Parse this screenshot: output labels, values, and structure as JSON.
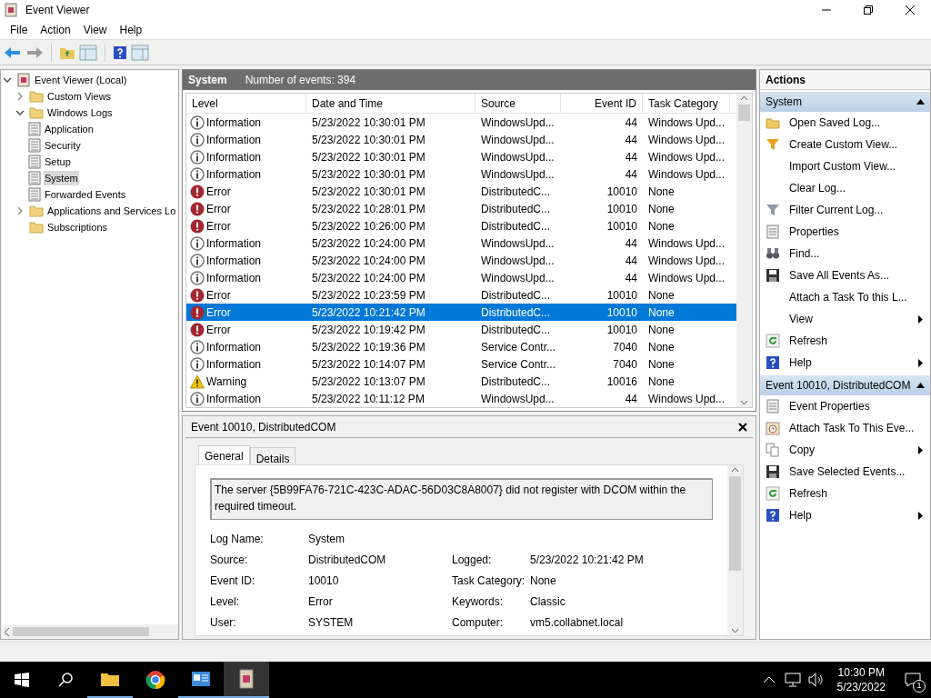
{
  "window": {
    "title": "Event Viewer"
  },
  "menu": [
    "File",
    "Action",
    "View",
    "Help"
  ],
  "tree": [
    {
      "label": "Event Viewer (Local)",
      "kind": "viewer",
      "expanded": true,
      "selected": false,
      "children": [
        {
          "label": "Custom Views",
          "kind": "folder",
          "expanded": false,
          "selected": false
        },
        {
          "label": "Windows Logs",
          "kind": "folder",
          "expanded": true,
          "selected": false,
          "children": [
            {
              "label": "Application",
              "kind": "log",
              "selected": false
            },
            {
              "label": "Security",
              "kind": "log",
              "selected": false
            },
            {
              "label": "Setup",
              "kind": "log",
              "selected": false
            },
            {
              "label": "System",
              "kind": "log",
              "selected": true
            },
            {
              "label": "Forwarded Events",
              "kind": "log",
              "selected": false
            }
          ]
        },
        {
          "label": "Applications and Services Lo",
          "kind": "folder",
          "expanded": false,
          "selected": false
        },
        {
          "label": "Subscriptions",
          "kind": "folder",
          "selected": false
        }
      ]
    }
  ],
  "events": {
    "title": "System",
    "count": "Number of events: 394",
    "columns": [
      "Level",
      "Date and Time",
      "Source",
      "Event ID",
      "Task Category"
    ],
    "rows": [
      {
        "kind": "info",
        "level": "Information",
        "date": "5/23/2022 10:30:01 PM",
        "source": "WindowsUpd...",
        "id": "44",
        "category": "Windows Upd...",
        "selected": false
      },
      {
        "kind": "info",
        "level": "Information",
        "date": "5/23/2022 10:30:01 PM",
        "source": "WindowsUpd...",
        "id": "44",
        "category": "Windows Upd...",
        "selected": false
      },
      {
        "kind": "info",
        "level": "Information",
        "date": "5/23/2022 10:30:01 PM",
        "source": "WindowsUpd...",
        "id": "44",
        "category": "Windows Upd...",
        "selected": false
      },
      {
        "kind": "info",
        "level": "Information",
        "date": "5/23/2022 10:30:01 PM",
        "source": "WindowsUpd...",
        "id": "44",
        "category": "Windows Upd...",
        "selected": false
      },
      {
        "kind": "error",
        "level": "Error",
        "date": "5/23/2022 10:30:01 PM",
        "source": "DistributedC...",
        "id": "10010",
        "category": "None",
        "selected": false
      },
      {
        "kind": "error",
        "level": "Error",
        "date": "5/23/2022 10:28:01 PM",
        "source": "DistributedC...",
        "id": "10010",
        "category": "None",
        "selected": false
      },
      {
        "kind": "error",
        "level": "Error",
        "date": "5/23/2022 10:26:00 PM",
        "source": "DistributedC...",
        "id": "10010",
        "category": "None",
        "selected": false
      },
      {
        "kind": "info",
        "level": "Information",
        "date": "5/23/2022 10:24:00 PM",
        "source": "WindowsUpd...",
        "id": "44",
        "category": "Windows Upd...",
        "selected": false
      },
      {
        "kind": "info",
        "level": "Information",
        "date": "5/23/2022 10:24:00 PM",
        "source": "WindowsUpd...",
        "id": "44",
        "category": "Windows Upd...",
        "selected": false
      },
      {
        "kind": "info",
        "level": "Information",
        "date": "5/23/2022 10:24:00 PM",
        "source": "WindowsUpd...",
        "id": "44",
        "category": "Windows Upd...",
        "selected": false
      },
      {
        "kind": "error",
        "level": "Error",
        "date": "5/23/2022 10:23:59 PM",
        "source": "DistributedC...",
        "id": "10010",
        "category": "None",
        "selected": false
      },
      {
        "kind": "error",
        "level": "Error",
        "date": "5/23/2022 10:21:42 PM",
        "source": "DistributedC...",
        "id": "10010",
        "category": "None",
        "selected": true
      },
      {
        "kind": "error",
        "level": "Error",
        "date": "5/23/2022 10:19:42 PM",
        "source": "DistributedC...",
        "id": "10010",
        "category": "None",
        "selected": false
      },
      {
        "kind": "info",
        "level": "Information",
        "date": "5/23/2022 10:19:36 PM",
        "source": "Service Contr...",
        "id": "7040",
        "category": "None",
        "selected": false
      },
      {
        "kind": "info",
        "level": "Information",
        "date": "5/23/2022 10:14:07 PM",
        "source": "Service Contr...",
        "id": "7040",
        "category": "None",
        "selected": false
      },
      {
        "kind": "warning",
        "level": "Warning",
        "date": "5/23/2022 10:13:07 PM",
        "source": "DistributedC...",
        "id": "10016",
        "category": "None",
        "selected": false
      },
      {
        "kind": "info",
        "level": "Information",
        "date": "5/23/2022 10:11:12 PM",
        "source": "WindowsUpd...",
        "id": "44",
        "category": "Windows Upd...",
        "selected": false
      }
    ]
  },
  "detail": {
    "title": "Event 10010, DistributedCOM",
    "tabs": [
      {
        "label": "General",
        "selected": true
      },
      {
        "label": "Details",
        "selected": false
      }
    ],
    "message": "The server {5B99FA76-721C-423C-ADAC-56D03C8A8007} did not register with DCOM within the required timeout.",
    "fields": [
      {
        "label": "Log Name:",
        "value": "System"
      },
      {
        "label": "Source:",
        "value": "DistributedCOM",
        "label2": "Logged:",
        "value2": "5/23/2022 10:21:42 PM"
      },
      {
        "label": "Event ID:",
        "value": "10010",
        "label2": "Task Category:",
        "value2": "None"
      },
      {
        "label": "Level:",
        "value": "Error",
        "label2": "Keywords:",
        "value2": "Classic"
      },
      {
        "label": "User:",
        "value": "SYSTEM",
        "label2": "Computer:",
        "value2": "vm5.collabnet.local"
      }
    ]
  },
  "actions": {
    "title": "Actions",
    "sections": [
      {
        "title": "System",
        "expanded": true,
        "items": [
          {
            "label": "Open Saved Log...",
            "kind": "folder",
            "submenu": false
          },
          {
            "label": "Create Custom View...",
            "kind": "funnel",
            "submenu": false
          },
          {
            "label": "Import Custom View...",
            "kind": "plain",
            "submenu": false
          },
          {
            "label": "Clear Log...",
            "kind": "plain",
            "submenu": false
          },
          {
            "label": "Filter Current Log...",
            "kind": "filter",
            "submenu": false
          },
          {
            "label": "Properties",
            "kind": "properties",
            "submenu": false
          },
          {
            "label": "Find...",
            "kind": "find",
            "submenu": false
          },
          {
            "label": "Save All Events As...",
            "kind": "save",
            "submenu": false
          },
          {
            "label": "Attach a Task To this L...",
            "kind": "plain",
            "submenu": false
          },
          {
            "label": "View",
            "kind": "plain",
            "submenu": true
          },
          {
            "label": "Refresh",
            "kind": "refresh",
            "submenu": false
          },
          {
            "label": "Help",
            "kind": "help",
            "submenu": true
          }
        ]
      },
      {
        "title": "Event 10010, DistributedCOM",
        "expanded": true,
        "items": [
          {
            "label": "Event Properties",
            "kind": "properties",
            "submenu": false
          },
          {
            "label": "Attach Task To This Eve...",
            "kind": "task",
            "submenu": false
          },
          {
            "label": "Copy",
            "kind": "copy",
            "submenu": true
          },
          {
            "label": "Save Selected Events...",
            "kind": "save",
            "submenu": false
          },
          {
            "label": "Refresh",
            "kind": "refresh",
            "submenu": false
          },
          {
            "label": "Help",
            "kind": "help",
            "submenu": true
          }
        ]
      }
    ]
  },
  "taskbar": {
    "time": "10:30 PM",
    "date": "5/23/2022",
    "notifications": "1"
  }
}
